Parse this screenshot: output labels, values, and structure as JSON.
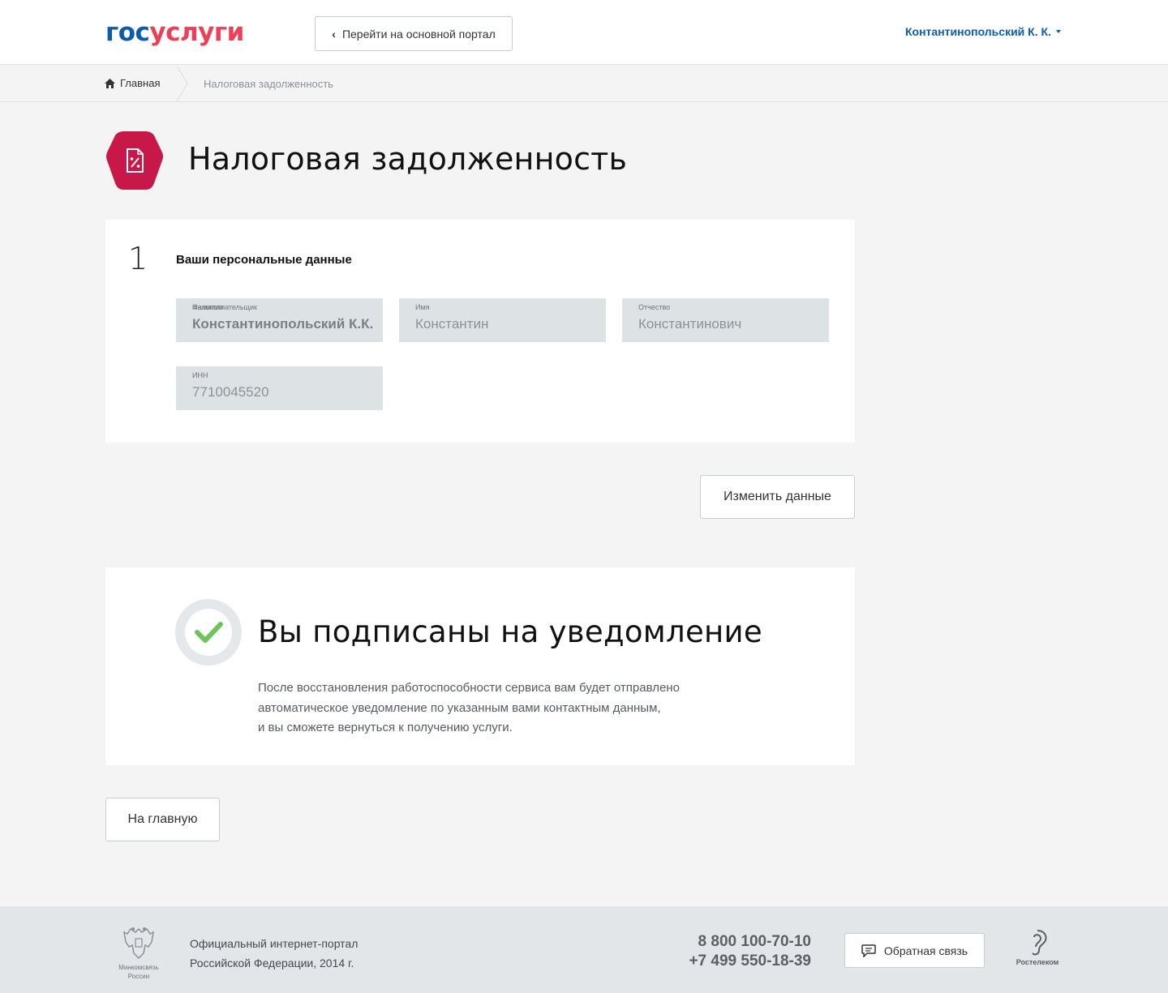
{
  "header": {
    "logo_part1": "гос",
    "logo_part2": "услуги",
    "portal_button": "Перейти на основной портал",
    "user_name": "Контантинопольский К. К."
  },
  "breadcrumbs": {
    "home": "Главная",
    "current": "Налоговая задолженность"
  },
  "page": {
    "title": "Налоговая задолженность"
  },
  "personal_data": {
    "step_number": "1",
    "title": "Ваши персональные данные",
    "fields": [
      {
        "label": "Фамилия",
        "label_overlay": "Налогоплательщик",
        "value": "Константинопольский К.К."
      },
      {
        "label": "Имя",
        "value": "Константин"
      },
      {
        "label": "Отчество",
        "value": "Константинович"
      },
      {
        "label": "ИНН",
        "value": "7710045520"
      }
    ],
    "edit_button": "Изменить данные"
  },
  "notice": {
    "title": "Вы подписаны на уведомление",
    "text_lines": [
      "После восстановления работоспособности сервиса вам будет отправлено",
      "автоматическое уведомление по указанным вами контактным данным,",
      "и вы сможете вернуться к получению услуги."
    ]
  },
  "home_button": "На главную",
  "footer": {
    "emblem_caption_1": "Минкомсвязь",
    "emblem_caption_2": "России",
    "text_line1": "Официальный интернет-портал",
    "text_line2": "Российской Федерации, 2014 г.",
    "phone1": "8 800 100-70-10",
    "phone2": "+7 499 550-18-39",
    "feedback_button": "Обратная связь",
    "partner": "Ростелеком"
  },
  "colors": {
    "brand_blue": "#0d5cab",
    "brand_red": "#ee3f58",
    "icon_crimson": "#c8184a",
    "check_green": "#6fc35b"
  }
}
